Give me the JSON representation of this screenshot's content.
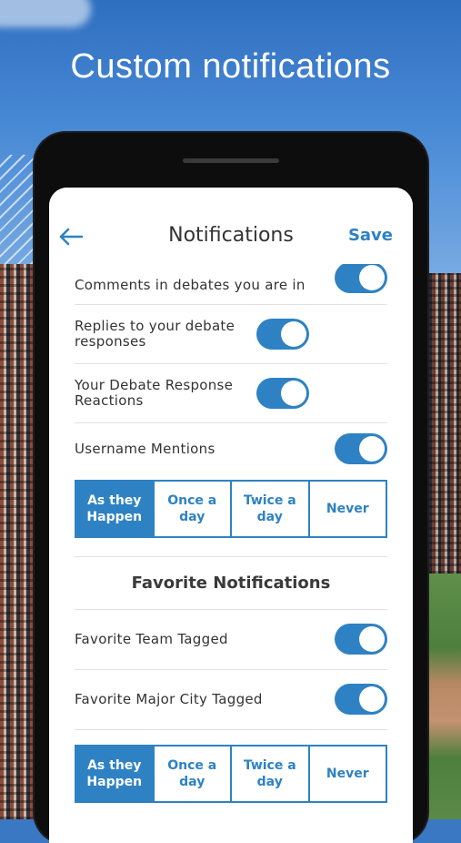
{
  "headline": "Custom notifications",
  "nav": {
    "title": "Notifications",
    "save_label": "Save",
    "back_icon": "arrow-left-icon"
  },
  "rows_top": [
    {
      "label": "Comments in debates you are in",
      "on": true
    },
    {
      "label": "Replies to your debate responses",
      "on": true
    },
    {
      "label": "Your Debate Response Reactions",
      "on": true
    },
    {
      "label": "Username Mentions",
      "on": true
    }
  ],
  "frequency_1": {
    "options": [
      "As they Happen",
      "Once a day",
      "Twice a day",
      "Never"
    ],
    "selected": "As they Happen"
  },
  "favorites": {
    "title": "Favorite Notifications",
    "rows": [
      {
        "label": "Favorite Team Tagged",
        "on": true
      },
      {
        "label": "Favorite Major City Tagged",
        "on": true
      }
    ]
  },
  "frequency_2": {
    "options": [
      "As they Happen",
      "Once a day",
      "Twice a day",
      "Never"
    ],
    "selected": "As they Happen"
  },
  "colors": {
    "accent": "#2e82c4",
    "text": "#333333"
  }
}
